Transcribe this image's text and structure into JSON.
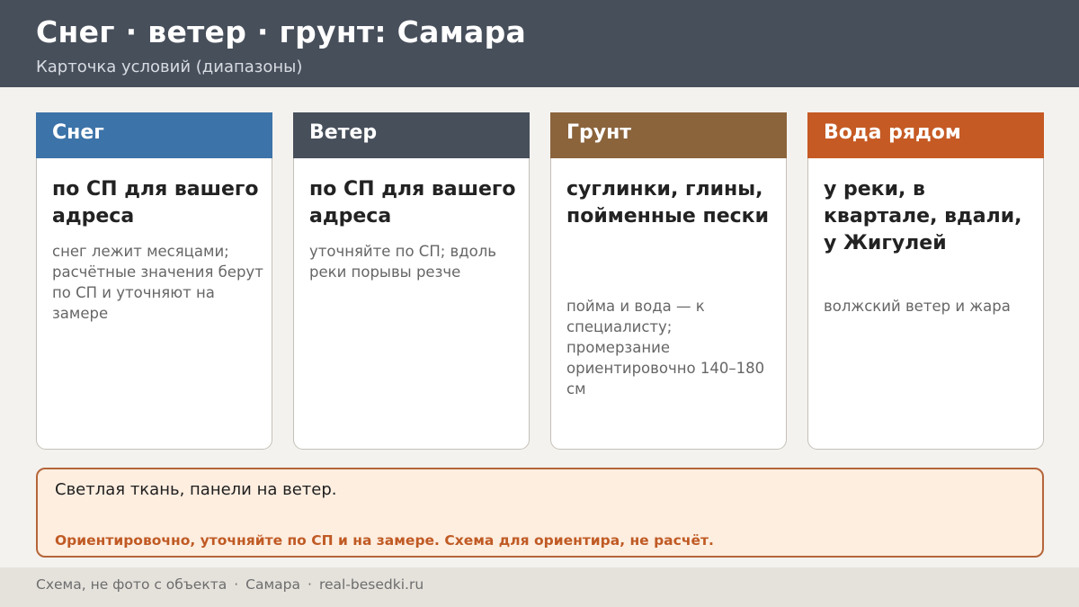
{
  "header": {
    "title": "Снег · ветер · грунт: Самара",
    "subtitle": "Карточка условий (диапазоны)"
  },
  "cards": [
    {
      "label": "Снег",
      "color": "#3c73a8",
      "main": "по СП для вашего адреса",
      "note": "снег лежит месяцами; расчётные значения берут по СП и уточняют на замере"
    },
    {
      "label": "Ветер",
      "color": "#474f5b",
      "main": "по СП для вашего адреса",
      "note": "уточняйте по СП; вдоль реки порывы резче"
    },
    {
      "label": "Грунт",
      "color": "#8b643c",
      "main": "суглинки, глины, пойменные пески",
      "note": "пойма и вода — к специалисту; промерзание ориентировочно 140–180 см"
    },
    {
      "label": "Вода рядом",
      "color": "#c55a24",
      "main": "у реки, в квартале, вдали, у Жигулей",
      "note": "волжский ветер и жара"
    }
  ],
  "note_box": {
    "text": "Светлая ткань, панели на ветер.",
    "warning": "Ориентировочно, уточняйте по СП и на замере. Схема для ориентира, не расчёт."
  },
  "footer": {
    "part1": "Схема, не фото с объекта",
    "separator": "·",
    "part2": "Самара",
    "part3": "real-besedki.ru"
  }
}
